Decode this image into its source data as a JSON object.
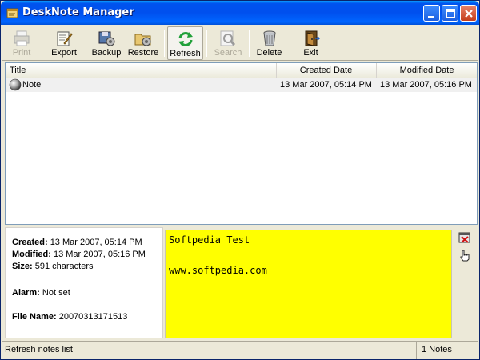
{
  "window": {
    "title": "DeskNote Manager",
    "titlebar_color": "#0054e3"
  },
  "toolbar": {
    "items": [
      {
        "label": "Print",
        "icon": "printer-icon",
        "enabled": false
      },
      {
        "label": "Export",
        "icon": "export-icon",
        "enabled": true
      },
      {
        "label": "Backup",
        "icon": "backup-icon",
        "enabled": true
      },
      {
        "label": "Restore",
        "icon": "restore-icon",
        "enabled": true
      },
      {
        "label": "Refresh",
        "icon": "refresh-icon",
        "enabled": true,
        "pressed": true
      },
      {
        "label": "Search",
        "icon": "search-icon",
        "enabled": false
      },
      {
        "label": "Delete",
        "icon": "trash-icon",
        "enabled": true
      },
      {
        "label": "Exit",
        "icon": "exit-door-icon",
        "enabled": true
      }
    ]
  },
  "list": {
    "columns": [
      "Title",
      "Created Date",
      "Modified Date"
    ],
    "rows": [
      {
        "title": "Note",
        "created": "13 Mar 2007, 05:14 PM",
        "modified": "13 Mar 2007, 05:16 PM",
        "icon": "note-sphere-icon"
      }
    ]
  },
  "details": {
    "created_label": "Created:",
    "created_value": "13 Mar 2007, 05:14 PM",
    "modified_label": "Modified:",
    "modified_value": "13 Mar 2007, 05:16 PM",
    "size_label": "Size:",
    "size_value": "591 characters",
    "alarm_label": "Alarm:",
    "alarm_value": "Not set",
    "filename_label": "File Name:",
    "filename_value": "20070313171513"
  },
  "note": {
    "line1": "Softpedia Test",
    "line2": "www.softpedia.com",
    "background": "#ffff00"
  },
  "side_icons": [
    "close-note-icon",
    "pointer-hand-icon"
  ],
  "status": {
    "message": "Refresh notes list",
    "count": "1 Notes"
  }
}
